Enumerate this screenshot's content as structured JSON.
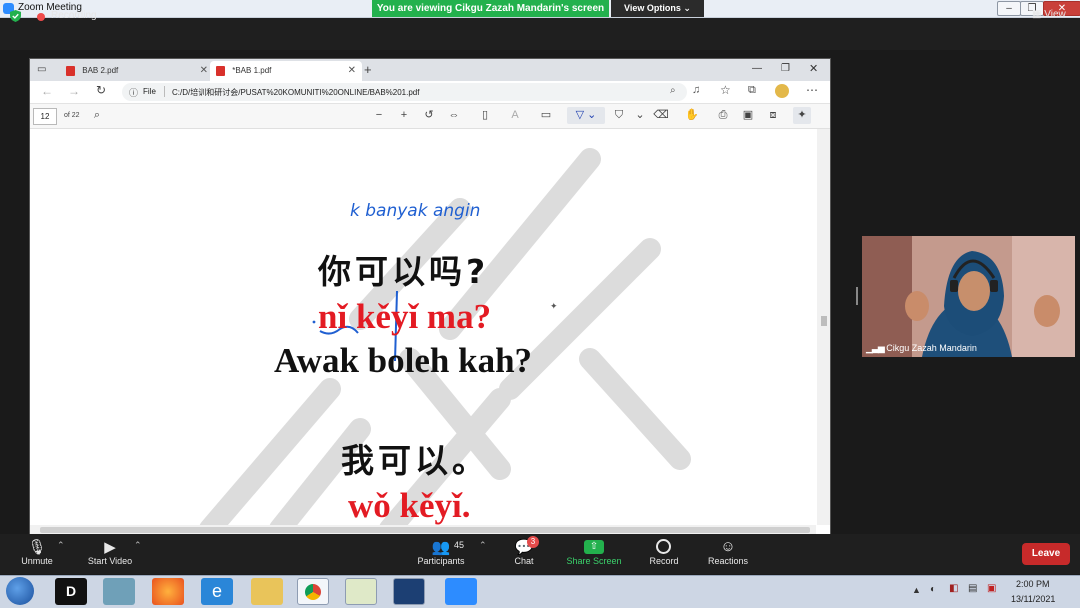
{
  "window": {
    "title": "Zoom Meeting",
    "banner": "You are viewing Cikgu Zazah Mandarin's screen",
    "view_options": "View Options",
    "minimize": "–",
    "restore": "❐",
    "close": "✕"
  },
  "meeting_bar": {
    "recording_label": "Recording",
    "view_label": "View"
  },
  "browser": {
    "tabs": [
      {
        "label": "BAB 2.pdf"
      },
      {
        "label": "*BAB 1.pdf"
      }
    ],
    "new_tab": "+",
    "file_label": "File",
    "url": "C:/D/培训和研讨会/PUSAT%20KOMUNITI%20ONLINE/BAB%201.pdf",
    "page_current": "12",
    "page_total": "of 22"
  },
  "slide": {
    "annotation": "k banyak angin",
    "question_chinese": "你可以吗?",
    "question_pinyin": "nǐ kěyǐ ma?",
    "question_malay": "Awak boleh kah?",
    "answer_chinese": "我可以。",
    "answer_pinyin": "wǒ kěyǐ."
  },
  "video": {
    "participant_name": "Cikgu Zazah Mandarin"
  },
  "controls": {
    "unmute": "Unmute",
    "start_video": "Start Video",
    "participants_count": "45",
    "participants": "Participants",
    "chat": "Chat",
    "chat_badge": "3",
    "share_screen": "Share Screen",
    "record": "Record",
    "reactions": "Reactions",
    "leave": "Leave"
  },
  "taskbar": {
    "time": "2:00 PM",
    "date": "13/11/2021"
  },
  "colors": {
    "banner_green": "#23b14d",
    "leave_red": "#c72a2a",
    "pinyin_red": "#e31b23",
    "annotation_blue": "#1f5fd1"
  }
}
